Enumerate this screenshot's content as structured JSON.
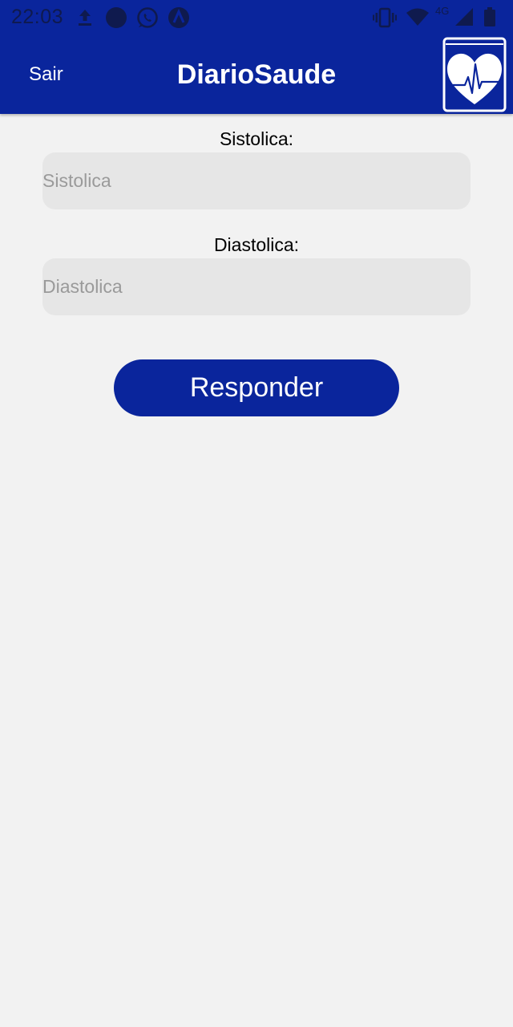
{
  "status_bar": {
    "time": "22:03",
    "network": "4G",
    "left_icons": [
      "upload-icon",
      "notification-dot-icon",
      "whatsapp-icon",
      "app-a-icon"
    ],
    "right_icons": [
      "vibrate-icon",
      "wifi-icon",
      "signal-icon",
      "battery-icon"
    ]
  },
  "app_bar": {
    "exit_label": "Sair",
    "title": "DiarioSaude",
    "logo_icon": "heart-book-logo-icon"
  },
  "form": {
    "systolic": {
      "label": "Sistolica:",
      "placeholder": "Sistolica",
      "value": ""
    },
    "diastolic": {
      "label": "Diastolica:",
      "placeholder": "Diastolica",
      "value": ""
    },
    "submit_label": "Responder"
  },
  "colors": {
    "primary": "#0a259c",
    "background": "#f2f2f2",
    "input_background": "#e6e6e6",
    "placeholder": "#9a9a9a"
  }
}
